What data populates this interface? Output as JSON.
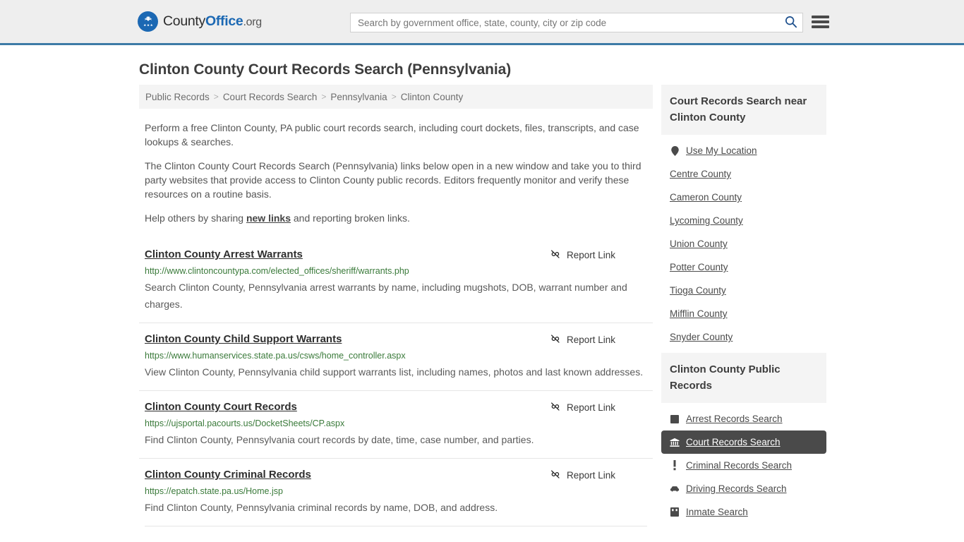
{
  "header": {
    "logo": {
      "part1": "County",
      "part2": "Office",
      "part3": ".org",
      "icon": "eagle-shield-icon"
    },
    "search": {
      "placeholder": "Search by government office, state, county, city or zip code",
      "value": "",
      "icon": "search-icon"
    },
    "menu_icon": "hamburger-menu-icon",
    "brand_color": "#1b68b3",
    "border_color": "#3d7ba6"
  },
  "page": {
    "title": "Clinton County Court Records Search (Pennsylvania)"
  },
  "breadcrumb": {
    "items": [
      {
        "label": "Public Records"
      },
      {
        "label": "Court Records Search"
      },
      {
        "label": "Pennsylvania"
      },
      {
        "label": "Clinton County"
      }
    ],
    "separator": ">"
  },
  "intro": {
    "p1": "Perform a free Clinton County, PA public court records search, including court dockets, files, transcripts, and case lookups & searches.",
    "p2": "The Clinton County Court Records Search (Pennsylvania) links below open in a new window and take you to third party websites that provide access to Clinton County public records. Editors frequently monitor and verify these resources on a routine basis.",
    "p3_before": "Help others by sharing ",
    "p3_link": "new links",
    "p3_after": " and reporting broken links."
  },
  "results": {
    "report_label": "Report Link",
    "report_icon": "broken-link-icon",
    "items": [
      {
        "title": "Clinton County Arrest Warrants",
        "url": "http://www.clintoncountypa.com/elected_offices/sheriff/warrants.php",
        "description": "Search Clinton County, Pennsylvania arrest warrants by name, including mugshots, DOB, warrant number and charges."
      },
      {
        "title": "Clinton County Child Support Warrants",
        "url": "https://www.humanservices.state.pa.us/csws/home_controller.aspx",
        "description": "View Clinton County, Pennsylvania child support warrants list, including names, photos and last known addresses."
      },
      {
        "title": "Clinton County Court Records",
        "url": "https://ujsportal.pacourts.us/DocketSheets/CP.aspx",
        "description": "Find Clinton County, Pennsylvania court records by date, time, case number, and parties."
      },
      {
        "title": "Clinton County Criminal Records",
        "url": "https://epatch.state.pa.us/Home.jsp",
        "description": "Find Clinton County, Pennsylvania criminal records by name, DOB, and address."
      }
    ]
  },
  "sidebar": {
    "nearby": {
      "heading": "Court Records Search near Clinton County",
      "items": [
        {
          "label": "Use My Location",
          "icon": "map-pin-icon"
        },
        {
          "label": "Centre County",
          "icon": ""
        },
        {
          "label": "Cameron County",
          "icon": ""
        },
        {
          "label": "Lycoming County",
          "icon": ""
        },
        {
          "label": "Union County",
          "icon": ""
        },
        {
          "label": "Potter County",
          "icon": ""
        },
        {
          "label": "Tioga County",
          "icon": ""
        },
        {
          "label": "Mifflin County",
          "icon": ""
        },
        {
          "label": "Snyder County",
          "icon": ""
        }
      ]
    },
    "public_records": {
      "heading": "Clinton County Public Records",
      "items": [
        {
          "label": "Arrest Records Search",
          "icon": "fingerprint-icon",
          "active": false
        },
        {
          "label": "Court Records Search",
          "icon": "courthouse-icon",
          "active": true
        },
        {
          "label": "Criminal Records Search",
          "icon": "exclamation-icon",
          "active": false
        },
        {
          "label": "Driving Records Search",
          "icon": "car-icon",
          "active": false
        },
        {
          "label": "Inmate Search",
          "icon": "inmate-icon",
          "active": false
        }
      ],
      "active_bg": "#4a4a4a"
    }
  }
}
